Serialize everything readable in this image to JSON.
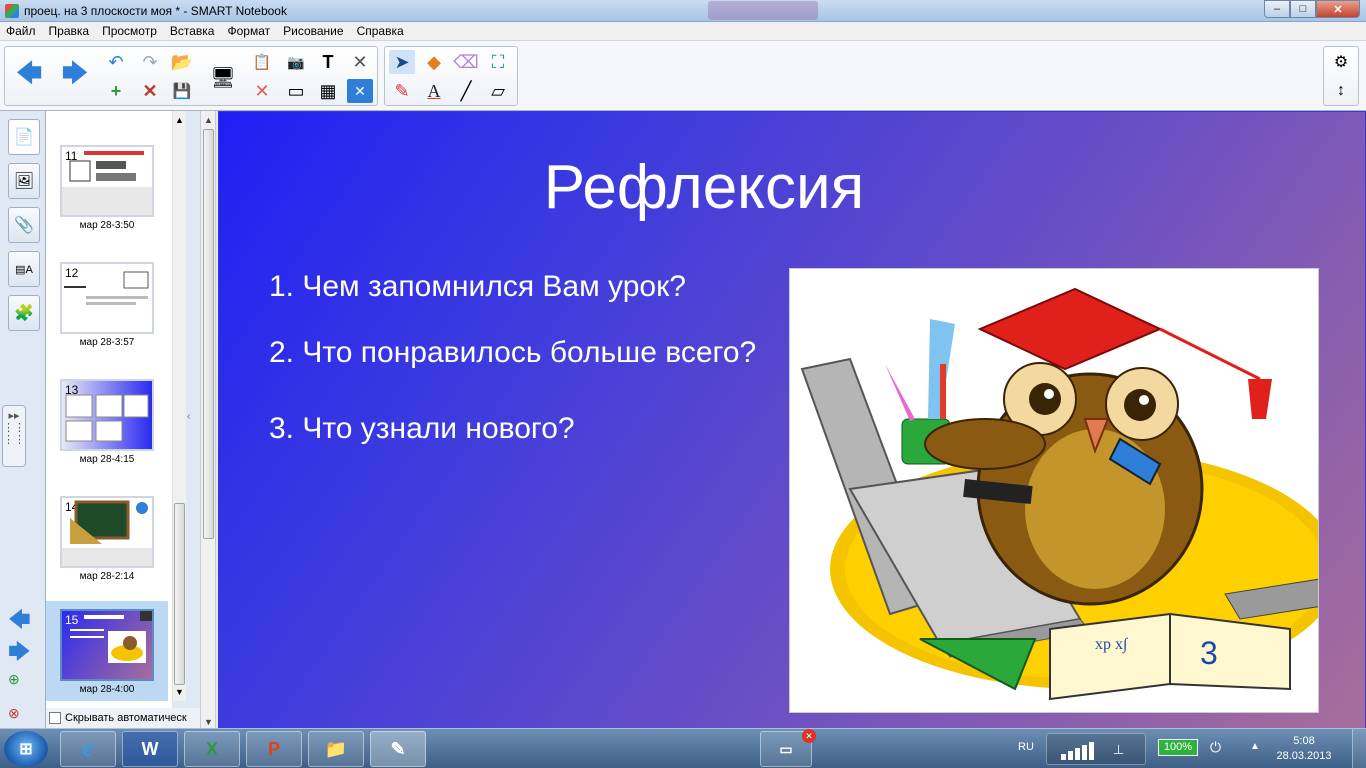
{
  "window": {
    "title": "проец. на 3 плоскости моя * - SMART Notebook",
    "controls": {
      "minimize": "–",
      "maximize": "□",
      "close": "✕"
    }
  },
  "menu": [
    "Файл",
    "Правка",
    "Просмотр",
    "Вставка",
    "Формат",
    "Рисование",
    "Справка"
  ],
  "toolbar_icons": {
    "back": "🡄",
    "forward": "🡆",
    "undo": "↶",
    "redo": "↷",
    "open": "📂",
    "add_page": "+",
    "delete_page": "✕",
    "save": "💾",
    "display": "🖥",
    "paste": "📋",
    "delete": "✕",
    "screen_shade": "▭",
    "camera": "📷",
    "table": "▦",
    "text_tool": "T",
    "measure": "✕",
    "select": "➤",
    "pens": "✎",
    "shapes": "◆",
    "text_color": "A",
    "eraser": "⌫",
    "line": "╱",
    "fill": "⛶",
    "eraser2": "▱",
    "settings": "⚙",
    "move_toolbar": "↕"
  },
  "sidebar": {
    "tabs": [
      "📄",
      "🖼",
      "📎",
      "▤A",
      "🧩"
    ],
    "nav_back": "🡄",
    "nav_forward": "🡆"
  },
  "sorter": {
    "pages": [
      {
        "number": "11",
        "label": "мар 28-3:50",
        "theme": "white"
      },
      {
        "number": "12",
        "label": "мар 28-3:57",
        "theme": "white"
      },
      {
        "number": "13",
        "label": "мар 28-4:15",
        "theme": "blue"
      },
      {
        "number": "14",
        "label": "мар 28-2:14",
        "theme": "board"
      },
      {
        "number": "15",
        "label": "мар 28-4:00",
        "theme": "selected"
      }
    ],
    "hide_automatically": "Скрывать автоматическ"
  },
  "slide": {
    "title": "Рефлексия",
    "questions": [
      "1. Чем запомнился Вам урок?",
      "2. Что понравилось больше всего?",
      "3. Что узнали нового?"
    ]
  },
  "taskbar": {
    "apps": [
      "e",
      "W",
      "X",
      "P",
      "📁",
      "✎"
    ],
    "language": "RU",
    "battery": "100%",
    "time": "5:08",
    "date": "28.03.2013"
  }
}
